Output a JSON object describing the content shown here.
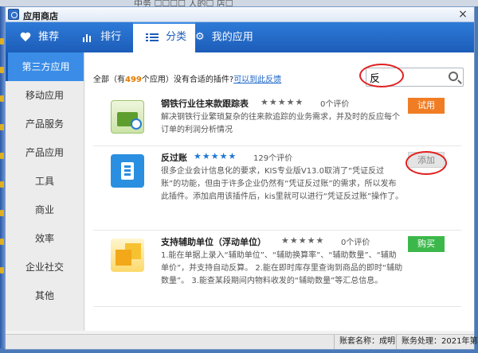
{
  "window": {
    "title": "应用商店",
    "close_symbol": "×"
  },
  "background_text": "中务   ☐☐☐☐ 人的☐ 店☐",
  "tabs": [
    {
      "label": "推荐",
      "icon": "heart-icon"
    },
    {
      "label": "排行",
      "icon": "bar-chart-icon"
    },
    {
      "label": "分类",
      "icon": "list-icon"
    },
    {
      "label": "我的应用",
      "icon": "gear-icon"
    }
  ],
  "sidebar": {
    "items": [
      {
        "label": "第三方应用"
      },
      {
        "label": "移动应用"
      },
      {
        "label": "产品服务"
      },
      {
        "label": "产品应用"
      },
      {
        "label": "工具"
      },
      {
        "label": "商业"
      },
      {
        "label": "效率"
      },
      {
        "label": "企业社交"
      },
      {
        "label": "其他"
      }
    ]
  },
  "summary": {
    "prefix": "全部（有",
    "count": "499",
    "suffix": "个应用）没有合适的插件?",
    "feedback_link": "可以到此反馈"
  },
  "search": {
    "value": "反",
    "placeholder": ""
  },
  "apps": [
    {
      "name": "钢铁行业往来款跟踪表",
      "stars": "★★★★★",
      "rating_text": "0个评价",
      "description": "解决钢铁行业繁琐复杂的往来款追踪的业务需求，并及时的反应每个订单的利润分析情况",
      "button": "试用",
      "icon": "steel-tracking-icon"
    },
    {
      "name": "反过账",
      "stars": "★★★★★",
      "rating_text": "129个评价",
      "description": "很多企业会计信息化的要求，KIS专业版V13.0取消了“凭证反过账”的功能，但由于许多企业仍然有“凭证反过账”的需求，所以发布此插件。添加启用该插件后，kis里就可以进行“凭证反过账”操作了。",
      "button": "添加",
      "icon": "reverse-posting-icon"
    },
    {
      "name": "支持辅助单位（浮动单位）",
      "stars": "★★★★★",
      "rating_text": "0个评价",
      "description": "1.能在单据上录入“辅助单位”、“辅助换算率”、“辅助数量”、“辅助单价”，并支持自动反算。 2.能在即时库存里查询到商品的即时“辅助数量”。 3.能查某段期间内物料收发的“辅助数量”等汇总信息。",
      "button": "购买",
      "icon": "auxiliary-unit-icon"
    }
  ],
  "statusbar": {
    "account": "账套名称：成明",
    "period": "账务处理：2021年第2期"
  },
  "colors": {
    "nav_blue": "#1c5db8",
    "active_blue": "#3a8ce6",
    "try_orange": "#f07d24",
    "buy_green": "#3cb84a",
    "annotation_red": "#e02020",
    "star_filled": "#1f77d4"
  }
}
